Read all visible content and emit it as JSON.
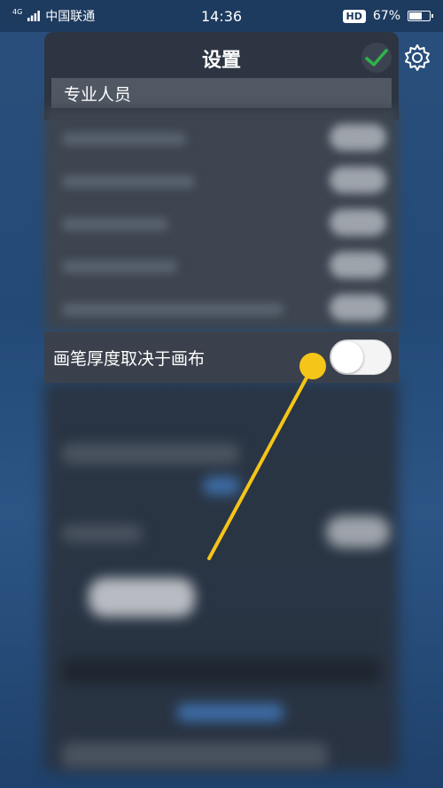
{
  "status_bar": {
    "network": "4G",
    "carrier": "中国联通",
    "time": "14:36",
    "hd_badge": "HD",
    "battery_percent": "67%",
    "battery_level": 0.67
  },
  "dialog": {
    "title": "设置",
    "confirm_icon": "check-icon",
    "settings_icon": "gear-icon"
  },
  "section": {
    "header": "专业人员"
  },
  "setting": {
    "label": "画笔厚度取决于画布",
    "toggle_state": "off"
  },
  "colors": {
    "dialog_bg": "#2d3542",
    "section_bg": "#505863",
    "check_green": "#2fb34a",
    "annotation_yellow": "#f5c518"
  }
}
